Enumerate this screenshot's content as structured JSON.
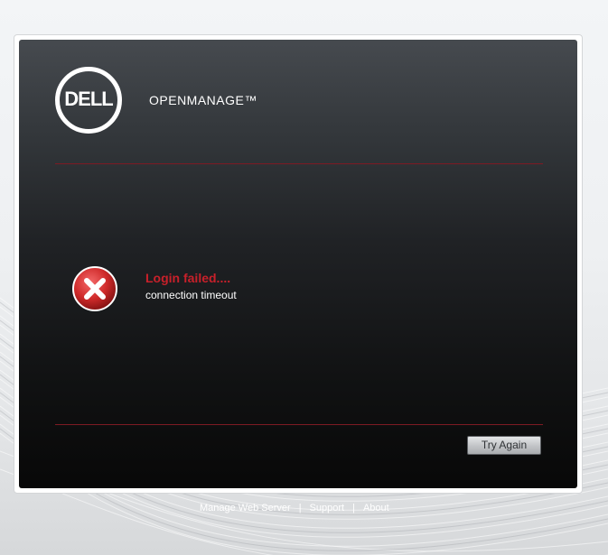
{
  "brand": {
    "logo_text": "DELL",
    "product_name": "OPENMANAGE™"
  },
  "error": {
    "title": "Login failed....",
    "message": "connection timeout",
    "icon": "error-x-icon"
  },
  "actions": {
    "try_again_label": "Try Again"
  },
  "footer": {
    "links": [
      {
        "label": "Manage Web Server"
      },
      {
        "label": "Support"
      },
      {
        "label": "About"
      }
    ],
    "separator": "|"
  },
  "colors": {
    "error_text": "#c8202a",
    "divider": "#7d1a24",
    "panel_top": "#464a4f",
    "panel_bottom": "#080808"
  }
}
